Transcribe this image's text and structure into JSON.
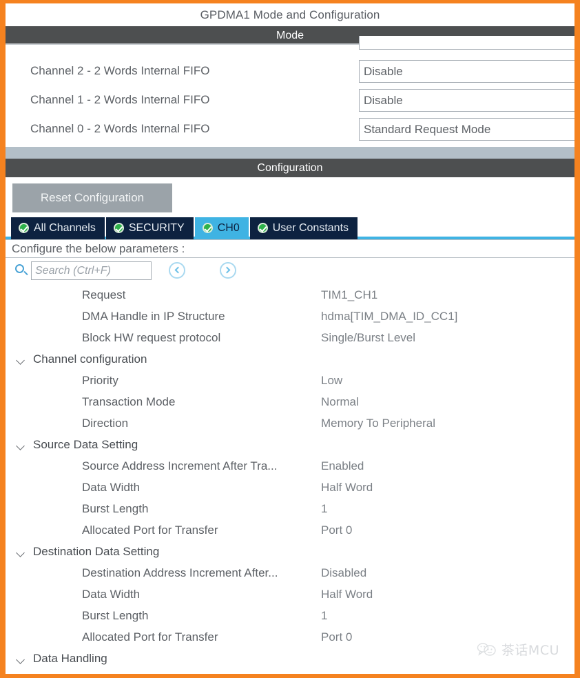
{
  "window": {
    "title": "GPDMA1 Mode and Configuration"
  },
  "colors": {
    "border_orange": "#f5821f",
    "section_header_bg": "#4d4f50",
    "tab_bg": "#0d2240",
    "tab_active_bg": "#3fb3e3",
    "check_green": "#2eb24a",
    "band_gray": "#b3bfc8",
    "button_gray": "#9ba3a9"
  },
  "mode_section": {
    "header": "Mode",
    "rows": [
      {
        "label": "Channel 2  - 2 Words Internal FIFO",
        "value": "Disable"
      },
      {
        "label": "Channel 1  - 2 Words Internal FIFO",
        "value": "Disable"
      },
      {
        "label": "Channel 0  - 2 Words Internal FIFO",
        "value": "Standard Request Mode"
      }
    ]
  },
  "configuration_section": {
    "header": "Configuration",
    "reset_button": "Reset Configuration",
    "tabs": [
      {
        "label": "All Channels",
        "icon": "check-circle-icon",
        "active": false
      },
      {
        "label": "SECURITY",
        "icon": "check-circle-icon",
        "active": false
      },
      {
        "label": "CH0",
        "icon": "check-circle-icon",
        "active": true
      },
      {
        "label": "User Constants",
        "icon": "check-circle-icon",
        "active": false
      }
    ],
    "hint": "Configure the below parameters :",
    "search": {
      "placeholder": "Search (Ctrl+F)",
      "value": "",
      "icon": "search-icon",
      "prev_icon": "chevron-left-circle-icon",
      "next_icon": "chevron-right-circle-icon"
    },
    "parameters": [
      {
        "type": "item",
        "label": "Request",
        "value": "TIM1_CH1"
      },
      {
        "type": "item",
        "label": "DMA Handle in IP Structure",
        "value": "hdma[TIM_DMA_ID_CC1]"
      },
      {
        "type": "item",
        "label": "Block HW request protocol",
        "value": "Single/Burst Level"
      },
      {
        "type": "group",
        "label": "Channel configuration",
        "value": ""
      },
      {
        "type": "item",
        "label": "Priority",
        "value": "Low"
      },
      {
        "type": "item",
        "label": "Transaction Mode",
        "value": "Normal"
      },
      {
        "type": "item",
        "label": "Direction",
        "value": "Memory To Peripheral"
      },
      {
        "type": "group",
        "label": "Source Data Setting",
        "value": ""
      },
      {
        "type": "item",
        "label": "Source Address Increment After Tra...",
        "value": "Enabled"
      },
      {
        "type": "item",
        "label": "Data Width",
        "value": "Half Word"
      },
      {
        "type": "item",
        "label": "Burst Length",
        "value": "1"
      },
      {
        "type": "item",
        "label": "Allocated Port for Transfer",
        "value": "Port 0"
      },
      {
        "type": "group",
        "label": "Destination Data Setting",
        "value": ""
      },
      {
        "type": "item",
        "label": "Destination Address Increment After...",
        "value": "Disabled"
      },
      {
        "type": "item",
        "label": "Data Width",
        "value": "Half Word"
      },
      {
        "type": "item",
        "label": "Burst Length",
        "value": "1"
      },
      {
        "type": "item",
        "label": "Allocated Port for Transfer",
        "value": "Port 0"
      },
      {
        "type": "group",
        "label": "Data Handling",
        "value": ""
      }
    ]
  },
  "watermark": {
    "text": "茶话MCU",
    "icon": "speech-bubble-face-icon"
  }
}
